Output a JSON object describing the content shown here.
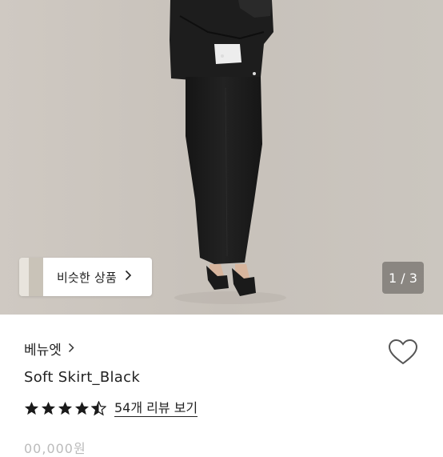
{
  "gallery": {
    "similar_button_label": "비슷한 상품",
    "image_counter": "1 / 3"
  },
  "product": {
    "brand": "베뉴엣",
    "title": "Soft Skirt_Black",
    "rating": 4.5,
    "review_link": "54개 리뷰 보기",
    "price_partial": "00,000원"
  },
  "icons": {
    "brand_chevron": "chevron-right-icon",
    "similar_chevron": "chevron-right-icon",
    "wishlist": "heart-outline-icon",
    "star": "star-icon"
  },
  "colors": {
    "star_fill": "#1a1a1a",
    "text": "#222222"
  }
}
